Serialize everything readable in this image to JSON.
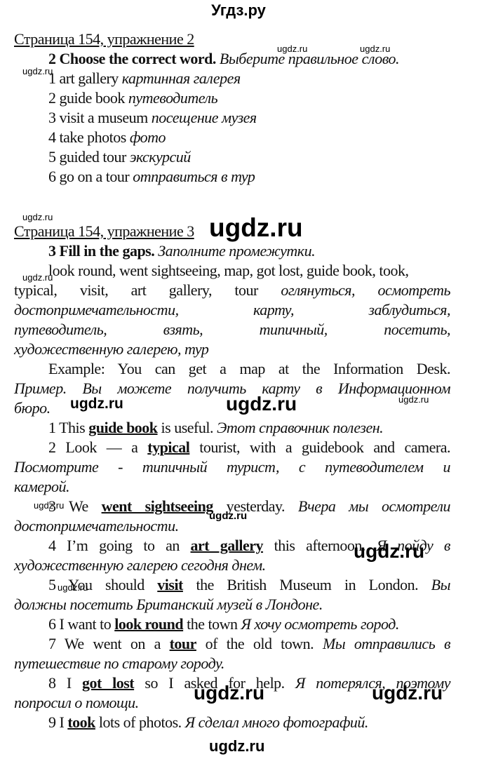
{
  "site_title": "Угдз.ру",
  "watermark": "ugdz.ru",
  "exercise2": {
    "heading": "Страница 154, упражнение 2",
    "instruction_num": "2",
    "instruction_en": "Choose the correct word.",
    "instruction_ru": "Выберите правильное слово.",
    "items": [
      {
        "en": "1 art gallery",
        "ru": "картинная галерея"
      },
      {
        "en": "2 guide book",
        "ru": "путеводитель"
      },
      {
        "en": "3 visit a museum",
        "ru": "посещение музея"
      },
      {
        "en": "4 take photos",
        "ru": "фото"
      },
      {
        "en": "5 guided tour",
        "ru": "экскурсий"
      },
      {
        "en": "6 go on a tour",
        "ru": "отправиться в тур"
      }
    ]
  },
  "exercise3": {
    "heading": "Страница 154, упражнение 3",
    "instruction_num": "3",
    "instruction_en": "Fill in the gaps.",
    "instruction_ru": "Заполните промежутки.",
    "word_bank_line1": "look round, went sightseeing, map, got lost, guide book, took,",
    "word_bank_line2_en": "typical, visit, art gallery, tour",
    "word_bank_line2_ru": "оглянуться, осмотреть",
    "word_bank_line3_ru": "достопримечательности, карту, заблудиться,",
    "word_bank_line4_ru": "путеводитель, взять, типичный, посетить,",
    "word_bank_line5_ru": "художественную галерею, тур",
    "example_en": "Example: You can get a map at the Information Desk.",
    "example_ru_1": "Пример. Вы можете получить карту в Информационном",
    "example_ru_2": "бюро.",
    "answers": [
      {
        "pre": "1 This ",
        "answer": "guide book",
        "post": " is useful. ",
        "ru": "Этот справочник полезен."
      },
      {
        "pre": "2 Look — a ",
        "answer": "typical",
        "post": " tourist, with a guidebook and camera.",
        "ru_1": "Посмотрите - типичный турист, с путеводителем и",
        "ru_2": "камерой."
      },
      {
        "pre": "3 We ",
        "answer": "went sightseeing",
        "post": " yesterday. ",
        "ru_1": "Вчера мы осмотрели",
        "ru_2": "достопримечательности."
      },
      {
        "pre": "4 I’m going to an ",
        "answer": "art gallery",
        "post": " this afternoon. ",
        "ru_1": "Я пойду в",
        "ru_2": "художественную галерею сегодня днем."
      },
      {
        "pre": "5 You should ",
        "answer": "visit",
        "post": " the British Museum in London. ",
        "ru_1": "Вы",
        "ru_2": "должны посетить Британский музей в Лондоне."
      },
      {
        "pre": "6 I want to ",
        "answer": "look round",
        "post": " the town ",
        "ru": "Я хочу осмотреть город."
      },
      {
        "pre": "7 We went on a ",
        "answer": "tour",
        "post": " of the old town. ",
        "ru_1": "Мы отправились в",
        "ru_2": "путешествие по старому городу."
      },
      {
        "pre": "8 I ",
        "answer": "got lost",
        "post": " so I asked for help. ",
        "ru_1": "Я потерялся, поэтому",
        "ru_2": "попросил о помощи."
      },
      {
        "pre": "9 I ",
        "answer": "took",
        "post": " lots of photos. ",
        "ru": "Я сделал много фотографий."
      }
    ]
  }
}
